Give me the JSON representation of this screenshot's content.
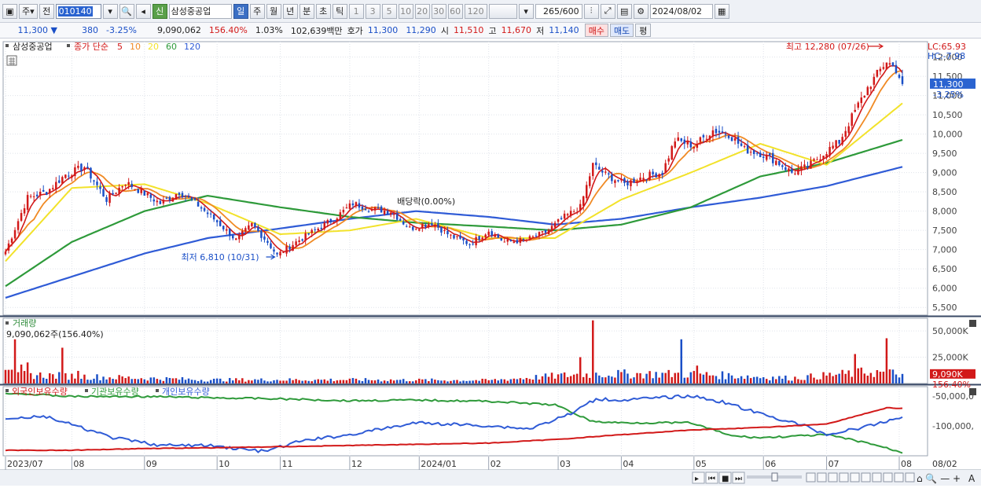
{
  "toolbar": {
    "btn_ju": "주",
    "btn_jeon": "전",
    "code": "010140",
    "shin": "신",
    "stock_name": "삼성중공업",
    "periods": [
      "일",
      "주",
      "월",
      "년",
      "분",
      "초",
      "틱"
    ],
    "active_period": "일",
    "intervals": [
      "1",
      "3",
      "5",
      "10",
      "20",
      "30",
      "60",
      "120"
    ],
    "count": "265",
    "count_max": "/600",
    "date": "2024/08/02"
  },
  "quote": {
    "price": "11,300",
    "change": "380",
    "change_pct": "-3.25%",
    "volume": "9,090,062",
    "volume_ratio": "156.40%",
    "turnover": "1.03%",
    "amount": "102,639백만",
    "ask_label": "호가",
    "ask": "11,300",
    "bid": "11,290",
    "open_label": "시",
    "open": "11,510",
    "high_label": "고",
    "high": "11,670",
    "low_label": "저",
    "low": "11,140",
    "buy_label": "매수",
    "sell_label": "매도",
    "eval_label": "평"
  },
  "colors": {
    "up": "#d21919",
    "down": "#1a4fc7",
    "ma5": "#d21919",
    "ma10": "#f08a24",
    "ma20": "#f2e22a",
    "ma60": "#2e9a3a",
    "ma120": "#2f5bd6"
  },
  "chart_data": {
    "type": "candlestick",
    "price_panel": {
      "legend_name": "삼성중공업",
      "legend_ma": "종가 단순",
      "ma_periods": [
        "5",
        "10",
        "20",
        "60",
        "120"
      ],
      "lc_label": "LC:65.93",
      "hc_label": "HC:-7.98",
      "ylim": [
        5300,
        12400
      ],
      "y_ticks": [
        5500,
        6000,
        6500,
        7000,
        7500,
        8000,
        8500,
        9000,
        9500,
        10000,
        10500,
        11000,
        11500,
        12000
      ],
      "y_tick_labels": [
        "5,500",
        "6,000",
        "6,500",
        "7,000",
        "7,500",
        "8,000",
        "8,500",
        "9,000",
        "9,500",
        "10,000",
        "10,500",
        "11,000",
        "11,500",
        "12,000"
      ],
      "current_price": 11300,
      "current_price_label": "11,300",
      "current_change_label": "-3.25%",
      "annotations": {
        "high": {
          "text": "최고 12,280 (07/26)",
          "date": "2024-07-26",
          "value": 12280
        },
        "low": {
          "text": "최저 6,810 (10/31)",
          "date": "2023-10-31",
          "value": 6810
        },
        "dividend": {
          "text": "배당락(0.00%)",
          "date": "2023-12-27"
        }
      },
      "close_anchors": [
        [
          "2023-07-03",
          6950
        ],
        [
          "2023-07-12",
          8350
        ],
        [
          "2023-07-20",
          8500
        ],
        [
          "2023-07-28",
          8950
        ],
        [
          "2023-08-07",
          9150
        ],
        [
          "2023-08-16",
          8300
        ],
        [
          "2023-08-24",
          8750
        ],
        [
          "2023-08-31",
          8500
        ],
        [
          "2023-09-08",
          8200
        ],
        [
          "2023-09-18",
          8500
        ],
        [
          "2023-09-26",
          8150
        ],
        [
          "2023-10-05",
          7650
        ],
        [
          "2023-10-12",
          7250
        ],
        [
          "2023-10-19",
          7650
        ],
        [
          "2023-10-26",
          7200
        ],
        [
          "2023-10-31",
          6850
        ],
        [
          "2023-11-08",
          7200
        ],
        [
          "2023-11-16",
          7500
        ],
        [
          "2023-11-24",
          7800
        ],
        [
          "2023-12-04",
          8200
        ],
        [
          "2023-12-12",
          8050
        ],
        [
          "2023-12-20",
          8000
        ],
        [
          "2023-12-28",
          7550
        ],
        [
          "2024-01-08",
          7700
        ],
        [
          "2024-01-16",
          7350
        ],
        [
          "2024-01-24",
          7150
        ],
        [
          "2024-02-01",
          7500
        ],
        [
          "2024-02-08",
          7200
        ],
        [
          "2024-02-19",
          7250
        ],
        [
          "2024-02-27",
          7450
        ],
        [
          "2024-03-06",
          7850
        ],
        [
          "2024-03-13",
          8100
        ],
        [
          "2024-03-19",
          9200
        ],
        [
          "2024-03-25",
          8950
        ],
        [
          "2024-04-02",
          8700
        ],
        [
          "2024-04-10",
          8900
        ],
        [
          "2024-04-18",
          9000
        ],
        [
          "2024-04-24",
          9850
        ],
        [
          "2024-05-02",
          9700
        ],
        [
          "2024-05-10",
          10100
        ],
        [
          "2024-05-17",
          10000
        ],
        [
          "2024-05-24",
          9600
        ],
        [
          "2024-05-31",
          9500
        ],
        [
          "2024-06-07",
          9300
        ],
        [
          "2024-06-14",
          9000
        ],
        [
          "2024-06-21",
          9150
        ],
        [
          "2024-06-28",
          9500
        ],
        [
          "2024-07-05",
          9800
        ],
        [
          "2024-07-12",
          10600
        ],
        [
          "2024-07-18",
          11200
        ],
        [
          "2024-07-26",
          11900
        ],
        [
          "2024-07-31",
          11680
        ],
        [
          "2024-08-02",
          11300
        ]
      ],
      "ma_anchors": {
        "20": [
          [
            "2023-07-03",
            6700
          ],
          [
            "2023-08-01",
            8600
          ],
          [
            "2023-09-01",
            8700
          ],
          [
            "2023-10-01",
            8200
          ],
          [
            "2023-11-01",
            7400
          ],
          [
            "2023-12-01",
            7500
          ],
          [
            "2024-01-01",
            7800
          ],
          [
            "2024-02-01",
            7300
          ],
          [
            "2024-03-01",
            7300
          ],
          [
            "2024-04-01",
            8300
          ],
          [
            "2024-05-01",
            9000
          ],
          [
            "2024-06-01",
            9750
          ],
          [
            "2024-07-01",
            9200
          ],
          [
            "2024-08-02",
            10800
          ]
        ],
        "60": [
          [
            "2023-07-03",
            6050
          ],
          [
            "2023-08-01",
            7200
          ],
          [
            "2023-09-01",
            8000
          ],
          [
            "2023-10-01",
            8400
          ],
          [
            "2023-11-01",
            8100
          ],
          [
            "2023-12-01",
            7850
          ],
          [
            "2024-01-01",
            7700
          ],
          [
            "2024-02-01",
            7600
          ],
          [
            "2024-03-01",
            7500
          ],
          [
            "2024-04-01",
            7650
          ],
          [
            "2024-05-01",
            8100
          ],
          [
            "2024-06-01",
            8900
          ],
          [
            "2024-07-01",
            9250
          ],
          [
            "2024-08-02",
            9850
          ]
        ],
        "120": [
          [
            "2023-07-03",
            5750
          ],
          [
            "2023-08-01",
            6300
          ],
          [
            "2023-09-01",
            6900
          ],
          [
            "2023-10-01",
            7300
          ],
          [
            "2023-11-01",
            7550
          ],
          [
            "2023-12-01",
            7800
          ],
          [
            "2024-01-01",
            8000
          ],
          [
            "2024-02-01",
            7850
          ],
          [
            "2024-03-01",
            7650
          ],
          [
            "2024-04-01",
            7800
          ],
          [
            "2024-05-01",
            8100
          ],
          [
            "2024-06-01",
            8350
          ],
          [
            "2024-07-01",
            8650
          ],
          [
            "2024-08-02",
            9150
          ]
        ]
      }
    },
    "volume_panel": {
      "title": "거래량",
      "readout": "9,090,062주(156.40%)",
      "y_tick_labels": [
        "50,000K",
        "25,000K"
      ],
      "y_ticks": [
        50000,
        25000
      ],
      "ylim": [
        0,
        62000
      ],
      "current_label": "9,090K",
      "current_pct": "156.40%",
      "current_value": 9090,
      "spikes": [
        [
          "2023-07-06",
          42000
        ],
        [
          "2023-07-10",
          18000
        ],
        [
          "2023-07-12",
          20000
        ],
        [
          "2023-07-27",
          34000
        ],
        [
          "2023-08-03",
          12000
        ],
        [
          "2024-03-13",
          25000
        ],
        [
          "2024-03-19",
          60000
        ],
        [
          "2024-04-26",
          42000
        ],
        [
          "2024-05-03",
          17000
        ],
        [
          "2024-07-12",
          28000
        ],
        [
          "2024-07-26",
          43000
        ]
      ]
    },
    "flow_panel": {
      "legend": [
        "외국인보유수량",
        "기관보유수량",
        "개인보유수량"
      ],
      "series_colors": [
        "#d21919",
        "#2e9a3a",
        "#2f5bd6"
      ],
      "y_tick_labels": [
        "-50,000,0",
        "-100,000,"
      ],
      "foreign": [
        [
          "2023-07-03",
          0.96
        ],
        [
          "2023-08-01",
          0.96
        ],
        [
          "2023-09-01",
          0.93
        ],
        [
          "2023-10-01",
          0.92
        ],
        [
          "2023-11-01",
          0.9
        ],
        [
          "2023-12-01",
          0.88
        ],
        [
          "2024-01-01",
          0.86
        ],
        [
          "2024-02-01",
          0.84
        ],
        [
          "2024-03-01",
          0.78
        ],
        [
          "2024-04-01",
          0.7
        ],
        [
          "2024-05-01",
          0.62
        ],
        [
          "2024-06-01",
          0.58
        ],
        [
          "2024-07-01",
          0.52
        ],
        [
          "2024-07-26",
          0.25
        ],
        [
          "2024-08-02",
          0.26
        ]
      ],
      "institution": [
        [
          "2023-07-03",
          0.0
        ],
        [
          "2023-08-01",
          0.06
        ],
        [
          "2023-09-01",
          0.06
        ],
        [
          "2023-10-01",
          0.08
        ],
        [
          "2023-11-01",
          0.1
        ],
        [
          "2023-12-01",
          0.13
        ],
        [
          "2024-01-01",
          0.12
        ],
        [
          "2024-02-01",
          0.14
        ],
        [
          "2024-03-01",
          0.2
        ],
        [
          "2024-03-19",
          0.48
        ],
        [
          "2024-04-01",
          0.5
        ],
        [
          "2024-05-01",
          0.5
        ],
        [
          "2024-05-20",
          0.72
        ],
        [
          "2024-06-01",
          0.75
        ],
        [
          "2024-07-01",
          0.7
        ],
        [
          "2024-07-20",
          0.85
        ],
        [
          "2024-08-02",
          1.0
        ]
      ],
      "individual": [
        [
          "2023-07-03",
          0.42
        ],
        [
          "2023-07-20",
          0.4
        ],
        [
          "2023-08-20",
          0.75
        ],
        [
          "2023-09-10",
          0.88
        ],
        [
          "2023-10-01",
          0.88
        ],
        [
          "2023-10-25",
          0.98
        ],
        [
          "2023-11-10",
          0.8
        ],
        [
          "2023-12-01",
          0.7
        ],
        [
          "2024-01-01",
          0.5
        ],
        [
          "2024-02-01",
          0.55
        ],
        [
          "2024-02-20",
          0.6
        ],
        [
          "2024-03-10",
          0.35
        ],
        [
          "2024-03-20",
          0.1
        ],
        [
          "2024-04-01",
          0.12
        ],
        [
          "2024-05-01",
          0.05
        ],
        [
          "2024-05-15",
          0.15
        ],
        [
          "2024-06-01",
          0.35
        ],
        [
          "2024-06-20",
          0.55
        ],
        [
          "2024-07-01",
          0.7
        ],
        [
          "2024-07-20",
          0.55
        ],
        [
          "2024-08-02",
          0.4
        ]
      ]
    },
    "x_axis": {
      "tick_labels": [
        "2023/07",
        "08",
        "09",
        "10",
        "11",
        "12",
        "2024/01",
        "02",
        "03",
        "04",
        "05",
        "06",
        "07",
        "08"
      ],
      "tick_dates": [
        "2023-07-03",
        "2023-08-01",
        "2023-09-01",
        "2023-10-04",
        "2023-11-01",
        "2023-12-01",
        "2024-01-02",
        "2024-02-01",
        "2024-03-04",
        "2024-04-01",
        "2024-05-02",
        "2024-06-03",
        "2024-07-01",
        "2024-08-01"
      ],
      "right_label": "08/02"
    }
  }
}
